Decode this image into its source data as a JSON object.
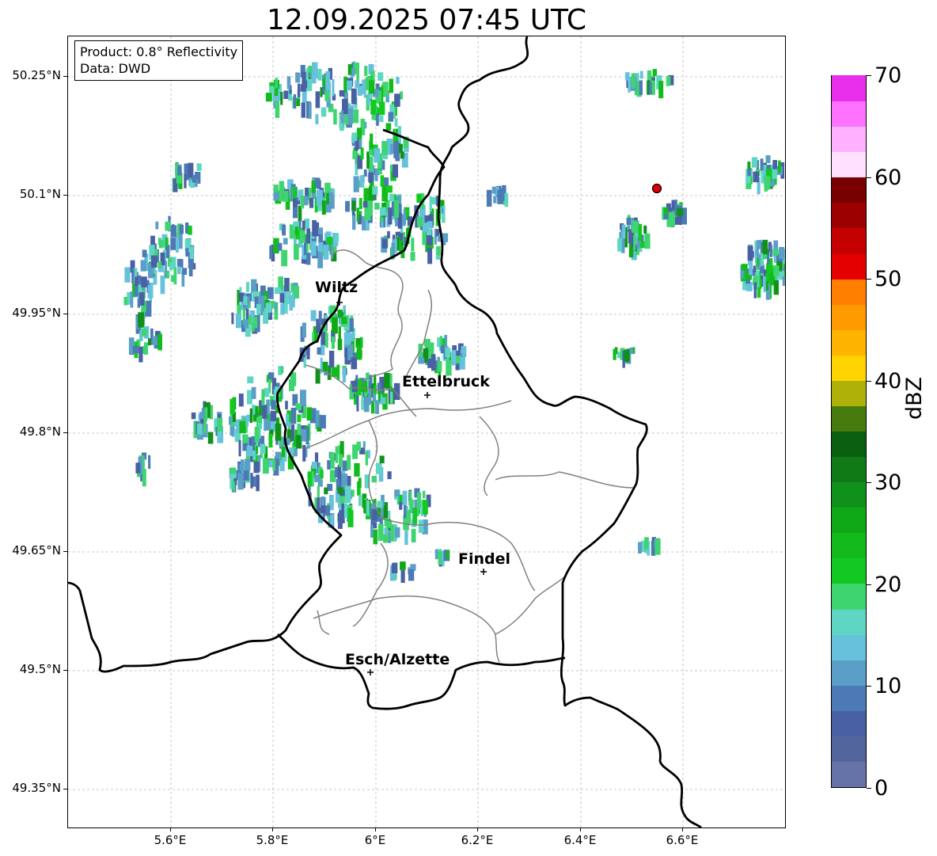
{
  "title": "12.09.2025 07:45 UTC",
  "info": {
    "product": "Product: 0.8° Reflectivity",
    "source": "Data: DWD"
  },
  "axes": {
    "lon_ticks": [
      "5.6°E",
      "5.8°E",
      "6°E",
      "6.2°E",
      "6.4°E",
      "6.6°E"
    ],
    "lat_ticks": [
      "50.25°N",
      "50.1°N",
      "49.95°N",
      "49.8°N",
      "49.65°N",
      "49.5°N",
      "49.35°N"
    ]
  },
  "colorbar": {
    "label": "dBZ",
    "tick_labels": [
      "0",
      "10",
      "20",
      "30",
      "40",
      "50",
      "60",
      "70"
    ],
    "colors": [
      "#6673a8",
      "#54659e",
      "#4961a3",
      "#4b7ab5",
      "#5b9ec8",
      "#66c1dd",
      "#5fd6c4",
      "#3ed46f",
      "#12c922",
      "#12ba1c",
      "#0ea715",
      "#10911b",
      "#0f7a16",
      "#0a5e10",
      "#477a0f",
      "#aeb108",
      "#ffd400",
      "#ffb400",
      "#ff9a00",
      "#ff7e00",
      "#e50000",
      "#c40000",
      "#9c0000",
      "#790000",
      "#ffe0ff",
      "#ffb2ff",
      "#ff72ff",
      "#e830ea"
    ]
  },
  "cities": [
    {
      "name": "Wiltz"
    },
    {
      "name": "Ettelbruck"
    },
    {
      "name": "Findel"
    },
    {
      "name": "Esch/Alzette"
    }
  ],
  "radar_site": {
    "name": "radar-site-marker",
    "color": "#e00000"
  }
}
